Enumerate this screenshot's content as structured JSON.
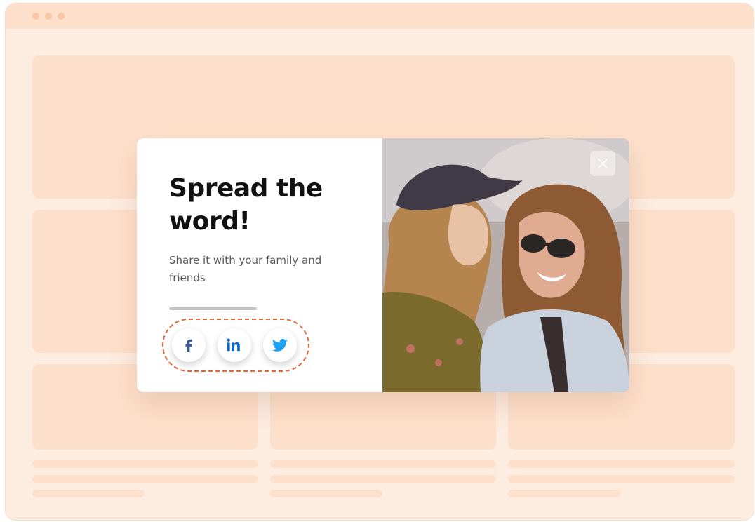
{
  "popup": {
    "headline": "Spread the word!",
    "subtext": "Share it with your family and friends",
    "share_buttons": [
      {
        "network": "facebook",
        "icon": "facebook-icon",
        "color": "#3b5998"
      },
      {
        "network": "linkedin",
        "icon": "linkedin-icon",
        "color": "#0a66c2"
      },
      {
        "network": "twitter",
        "icon": "twitter-icon",
        "color": "#1da1f2"
      }
    ],
    "close_icon": "close-icon"
  },
  "colors": {
    "page_background": "#fdece0",
    "placeholder": "#fde0cc",
    "highlight_dashed": "#e0683a",
    "headline": "#111111"
  }
}
